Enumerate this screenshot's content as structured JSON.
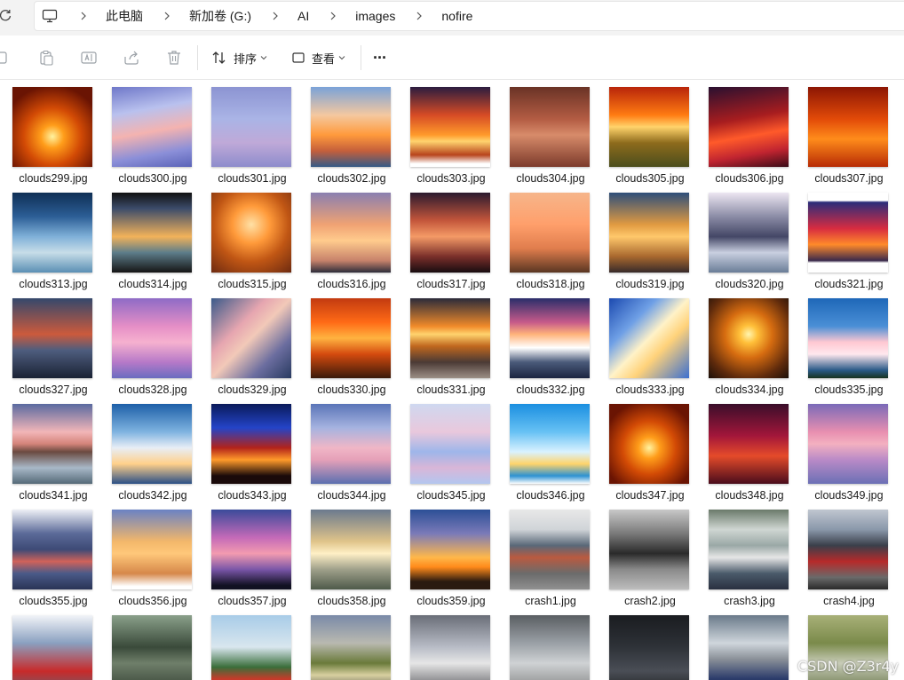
{
  "address": {
    "crumbs": [
      "此电脑",
      "新加卷 (G:)",
      "AI",
      "images",
      "nofire"
    ]
  },
  "toolbar": {
    "sort_label": "排序",
    "view_label": "查看",
    "more_label": "···"
  },
  "files": [
    {
      "name": "clouds299.jpg",
      "bg": "radial-gradient(circle at 50% 62%, #fff3a0 0%, #ff9d1a 18%, #d24a05 45%, #6a1403 80%)"
    },
    {
      "name": "clouds300.jpg",
      "bg": "linear-gradient(170deg, #6f78c9 0%, #b9c1ee 30%, #f4b3b0 55%, #8b8fd8 80%, #5a63b8 100%)"
    },
    {
      "name": "clouds301.jpg",
      "bg": "linear-gradient(180deg, #8c94d2 0%, #aab4e6 40%, #bfa9d8 70%, #8d8ccc 100%)"
    },
    {
      "name": "clouds302.jpg",
      "bg": "linear-gradient(180deg, #7aa2d8 0%, #f4c8a0 35%, #ff9a3c 60%, #c45f3b 80%, #345a86 100%)"
    },
    {
      "name": "clouds303.jpg",
      "bg": "linear-gradient(180deg, #2b1c3f 0%, #d64b25 35%, #ff9a2b 60%, #ffd36e 68%, #b8441c 85%, #ffffff 96%)"
    },
    {
      "name": "clouds304.jpg",
      "bg": "linear-gradient(180deg, #6a3326 0%, #b35c43 40%, #d78b6a 60%, #7c3a2b 100%)"
    },
    {
      "name": "clouds305.jpg",
      "bg": "linear-gradient(180deg, #b8250a 0%, #ff7b12 35%, #ffd36b 50%, #8d6b1c 70%, #4b4e1d 100%)"
    },
    {
      "name": "clouds306.jpg",
      "bg": "linear-gradient(170deg, #2a1030 0%, #a81d1f 40%, #ff5a2a 60%, #c02430 80%, #3a0c18 100%)"
    },
    {
      "name": "clouds307.jpg",
      "bg": "linear-gradient(180deg, #8c1604 0%, #e24a08 40%, #ff8c1b 65%, #b72b05 100%)"
    },
    {
      "name": "clouds313.jpg",
      "bg": "linear-gradient(180deg, #0f2f55 0%, #2c5e96 30%, #7fb0d8 55%, #c7dde8 75%, #5b8fb4 100%)"
    },
    {
      "name": "clouds314.jpg",
      "bg": "linear-gradient(180deg, #111111 0%, #3c4c6a 20%, #f2b25a 55%, #5d7d8a 75%, #151515 100%)"
    },
    {
      "name": "clouds315.jpg",
      "bg": "radial-gradient(circle at 50% 40%, #ffe1a6 0%, #ff9a3a 30%, #c05614 60%, #6d2a10 100%)"
    },
    {
      "name": "clouds316.jpg",
      "bg": "linear-gradient(180deg, #8a7fb0 0%, #f0a273 40%, #ffcb8d 60%, #c7826b 85%, #2d2d3a 100%)"
    },
    {
      "name": "clouds317.jpg",
      "bg": "linear-gradient(180deg, #2b1a2e 0%, #c4563b 35%, #f49a66 55%, #7a2f2a 80%, #180c10 100%)"
    },
    {
      "name": "clouds318.jpg",
      "bg": "linear-gradient(180deg, #f6b58a 0%, #ff9f6b 40%, #e07d4d 70%, #5a3622 100%)"
    },
    {
      "name": "clouds319.jpg",
      "bg": "linear-gradient(180deg, #2e4f7a 0%, #e09a41 40%, #ffc86b 55%, #a8682e 80%, #372a2a 100%)"
    },
    {
      "name": "clouds320.jpg",
      "bg": "linear-gradient(180deg, #ece6f1 0%, #8b8ca6 30%, #444766 55%, #c9cfe0 75%, #6a7d97 100%)"
    },
    {
      "name": "clouds321.jpg",
      "bg": "linear-gradient(180deg, #ffffff 0%, #ffffff 10%, #2b2d7a 12%, #d82c40 45%, #ff8a2a 65%, #3b2a4c 85%, #ffffff 88%)"
    },
    {
      "name": "clouds327.jpg",
      "bg": "linear-gradient(180deg, #34486c 0%, #cc5a3c 45%, #4e5d7e 65%, #1a2234 100%)"
    },
    {
      "name": "clouds328.jpg",
      "bg": "linear-gradient(180deg, #8e6bc6 0%, #e58ec6 35%, #f6b1cf 55%, #b679c8 80%, #6a6cc0 100%)"
    },
    {
      "name": "clouds329.jpg",
      "bg": "linear-gradient(135deg, #3a5a8a 0%, #e6a6b0 35%, #f2c9b8 50%, #6b6d9f 75%, #283a60 100%)"
    },
    {
      "name": "clouds330.jpg",
      "bg": "linear-gradient(180deg, #c23a10 0%, #ff6a16 30%, #ffb340 50%, #d44a0e 70%, #3a1a0a 100%)"
    },
    {
      "name": "clouds331.jpg",
      "bg": "linear-gradient(180deg, #2b2b3a 0%, #f08a2a 35%, #ffd36e 45%, #c0671e 60%, #4b3a35 80%, #9b8e85 100%)"
    },
    {
      "name": "clouds332.jpg",
      "bg": "linear-gradient(180deg, #2a2e6a 0%, #c65a8a 30%, #ffb37a 45%, #ffffff 62%, #4a5a7a 80%, #1b2440 100%)"
    },
    {
      "name": "clouds333.jpg",
      "bg": "linear-gradient(135deg, #1c4ab0 0%, #6fa0e6 30%, #fff2c8 50%, #ffd27a 65%, #3b6fd0 100%)"
    },
    {
      "name": "clouds334.jpg",
      "bg": "radial-gradient(circle at 50% 45%, #fff5b0 0%, #ffc03a 15%, #d66c10 40%, #5e2a0c 75%, #1c0f08 100%)"
    },
    {
      "name": "clouds335.jpg",
      "bg": "linear-gradient(180deg, #1e67b8 0%, #4a8fd6 35%, #ffc8d2 55%, #ffe8ee 70%, #2a5a88 90%, #18331e 100%)"
    },
    {
      "name": "clouds341.jpg",
      "bg": "linear-gradient(180deg, #5a6aa0 0%, #f2b6b8 35%, #d4837a 50%, #6a4a40 60%, #a8b8c8 80%, #556a78 100%)"
    },
    {
      "name": "clouds342.jpg",
      "bg": "linear-gradient(180deg, #1d5fa8 0%, #7fb3e0 35%, #e8eef6 55%, #ffd08a 75%, #2a4f86 100%)"
    },
    {
      "name": "clouds343.jpg",
      "bg": "linear-gradient(180deg, #0a1a5a 0%, #2444c8 30%, #b2231a 55%, #ff9a2a 70%, #1a0a0a 90%)"
    },
    {
      "name": "clouds344.jpg",
      "bg": "linear-gradient(180deg, #5a75b8 0%, #a6b3e0 30%, #f0b6c6 55%, #e5a0b8 70%, #5b6fb0 100%)"
    },
    {
      "name": "clouds345.jpg",
      "bg": "linear-gradient(180deg, #cfd8f0 0%, #e9c8dc 35%, #9eb6ea 60%, #d9b6d8 80%, #b3c6ef 100%)"
    },
    {
      "name": "clouds346.jpg",
      "bg": "linear-gradient(180deg, #1b8fe0 0%, #67c1f4 35%, #d9f2ff 60%, #ffd46b 75%, #2d92d2 90%, #ffffff 100%)"
    },
    {
      "name": "clouds347.jpg",
      "bg": "radial-gradient(circle at 50% 55%, #fff3a0 0%, #ff9d1a 18%, #d24a05 45%, #6a1403 80%)"
    },
    {
      "name": "clouds348.jpg",
      "bg": "linear-gradient(180deg, #3a0e2a 0%, #a3163a 40%, #e54b2a 65%, #4a0c1c 100%)"
    },
    {
      "name": "clouds349.jpg",
      "bg": "linear-gradient(180deg, #7a6ab8 0%, #e88fb0 35%, #f3b0c0 50%, #b98ac7 70%, #6b70b5 100%)"
    },
    {
      "name": "clouds355.jpg",
      "bg": "linear-gradient(180deg, #eef0f6 0%, #5b6a98 30%, #3d4a76 50%, #d0625a 65%, #4a5a88 80%, #2a3456 100%)"
    },
    {
      "name": "clouds356.jpg",
      "bg": "linear-gradient(180deg, #6a82c4 0%, #f3b76a 40%, #ffc87a 55%, #d6884a 80%, #ffffff 96%)"
    },
    {
      "name": "clouds357.jpg",
      "bg": "linear-gradient(180deg, #3a4a9a 0%, #c46ab8 35%, #f39bb0 55%, #7a56a8 75%, #111122 95%)"
    },
    {
      "name": "clouds358.jpg",
      "bg": "linear-gradient(180deg, #6b7a8e 0%, #e0c48a 40%, #fff0c6 55%, #9fa08a 75%, #4e5a4a 100%)"
    },
    {
      "name": "clouds359.jpg",
      "bg": "linear-gradient(180deg, #2c4f96 0%, #7a7ab8 30%, #ffb84a 60%, #ff8a1a 72%, #2a1a10 90%)"
    },
    {
      "name": "crash1.jpg",
      "bg": "linear-gradient(180deg, #e8e8e8 0%, #d0d4d8 25%, #596878 45%, #ba5a40 60%, #6b6b6b 80%, #909090 100%)"
    },
    {
      "name": "crash2.jpg",
      "bg": "linear-gradient(180deg, #c8c8c8 0%, #7a7a7a 30%, #2a2a2a 55%, #8a8a8a 75%, #bdbdbd 100%)"
    },
    {
      "name": "crash3.jpg",
      "bg": "linear-gradient(180deg, #6a7a6a 0%, #cfd6d2 25%, #9aa8a6 45%, #e6e6e6 60%, #4a5a6a 80%, #2a3040 100%)"
    },
    {
      "name": "crash4.jpg",
      "bg": "linear-gradient(180deg, #c0c6d0 0%, #8a98aa 25%, #3a3f4a 45%, #b62a2a 65%, #6a6a6a 85%, #2a2a2a 100%)"
    },
    {
      "name": "",
      "bg": "linear-gradient(180deg, #f2f4f8 0%, #8aa0c0 35%, #c82a2a 70%, #5a6a7a 100%)"
    },
    {
      "name": "",
      "bg": "linear-gradient(180deg, #8aa08a 0%, #3a4a3a 40%, #6f7f6a 60%, #2e3a2e 100%)"
    },
    {
      "name": "",
      "bg": "linear-gradient(180deg, #a8cce8 0%, #d8e6ee 40%, #3a6e3a 65%, #c83a2a 80%, #5a5a5a 100%)"
    },
    {
      "name": "",
      "bg": "linear-gradient(180deg, #7a8aa8 0%, #b9b9b0 35%, #6a7a3a 60%, #d8d0a0 75%, #3a3a3a 100%)"
    },
    {
      "name": "",
      "bg": "linear-gradient(180deg, #6a6e78 0%, #b8bcc6 40%, #e6e6e6 60%, #4a4a50 100%)"
    },
    {
      "name": "",
      "bg": "linear-gradient(180deg, #5a5e62 0%, #9aa0a6 35%, #cfd2d4 60%, #7a7a7a 100%)"
    },
    {
      "name": "",
      "bg": "linear-gradient(180deg, #1a1c20 0%, #2e3238 40%, #4a4e56 70%, #1a1a1a 100%)"
    },
    {
      "name": "",
      "bg": "linear-gradient(180deg, #6a7a8a 0%, #cfd6dc 35%, #8a9098 55%, #2a3a6a 80%, #4a4a4a 100%)"
    },
    {
      "name": "",
      "bg": "linear-gradient(180deg, #a8b078 0%, #7a8a4a 35%, #c8ccb8 60%, #5a6a3a 100%)"
    }
  ],
  "watermark": "CSDN @Z3r4y"
}
